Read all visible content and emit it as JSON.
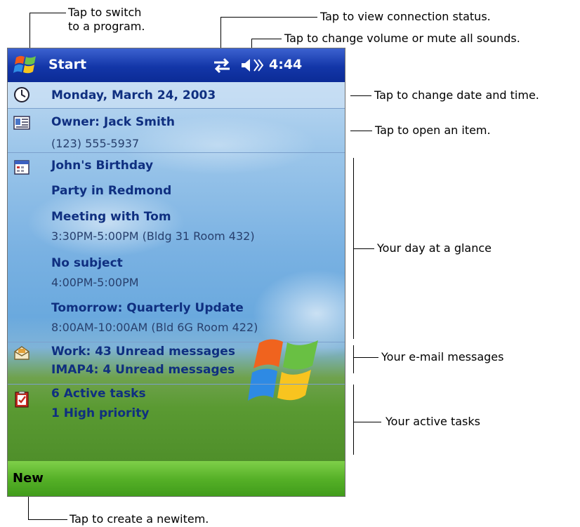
{
  "callouts": {
    "switch_program": [
      "Tap to switch",
      "to a program."
    ],
    "connection": "Tap to view connection status.",
    "volume": "Tap to change volume or mute all sounds.",
    "date_time": "Tap to change date and time.",
    "open_item": "Tap to open an item.",
    "day_glance": "Your day at a glance",
    "email": "Your e-mail messages",
    "tasks": "Your active tasks",
    "new_item": "Tap to create a newitem."
  },
  "titlebar": {
    "start_label": "Start",
    "time": "4:44"
  },
  "today": {
    "date": "Monday, March 24, 2003",
    "owner": "Owner: Jack Smith",
    "phone": "(123) 555-5937",
    "appointments": [
      {
        "title": "John's Birthday",
        "detail": ""
      },
      {
        "title": "Party in Redmond",
        "detail": ""
      },
      {
        "title": "Meeting with Tom",
        "detail": "3:30PM-5:00PM (Bldg 31 Room 432)"
      },
      {
        "title": "No subject",
        "detail": "4:00PM-5:00PM"
      },
      {
        "title": "Tomorrow: Quarterly Update",
        "detail": "8:00AM-10:00AM (Bld 6G Room 422)"
      }
    ],
    "messages": [
      "Work: 43 Unread messages",
      "IMAP4: 4 Unread messages"
    ],
    "tasks": [
      "6 Active tasks",
      "1 High priority"
    ]
  },
  "menubar": {
    "new_label": "New"
  },
  "colors": {
    "titlebar": "#1336a8",
    "menubar": "#55b027",
    "text_blue": "#0f2f80"
  },
  "icons": [
    "windows-flag-icon",
    "connection-arrows-icon",
    "speaker-muted-icon",
    "clock-icon",
    "owner-card-icon",
    "calendar-icon",
    "envelope-icon",
    "task-check-icon"
  ]
}
